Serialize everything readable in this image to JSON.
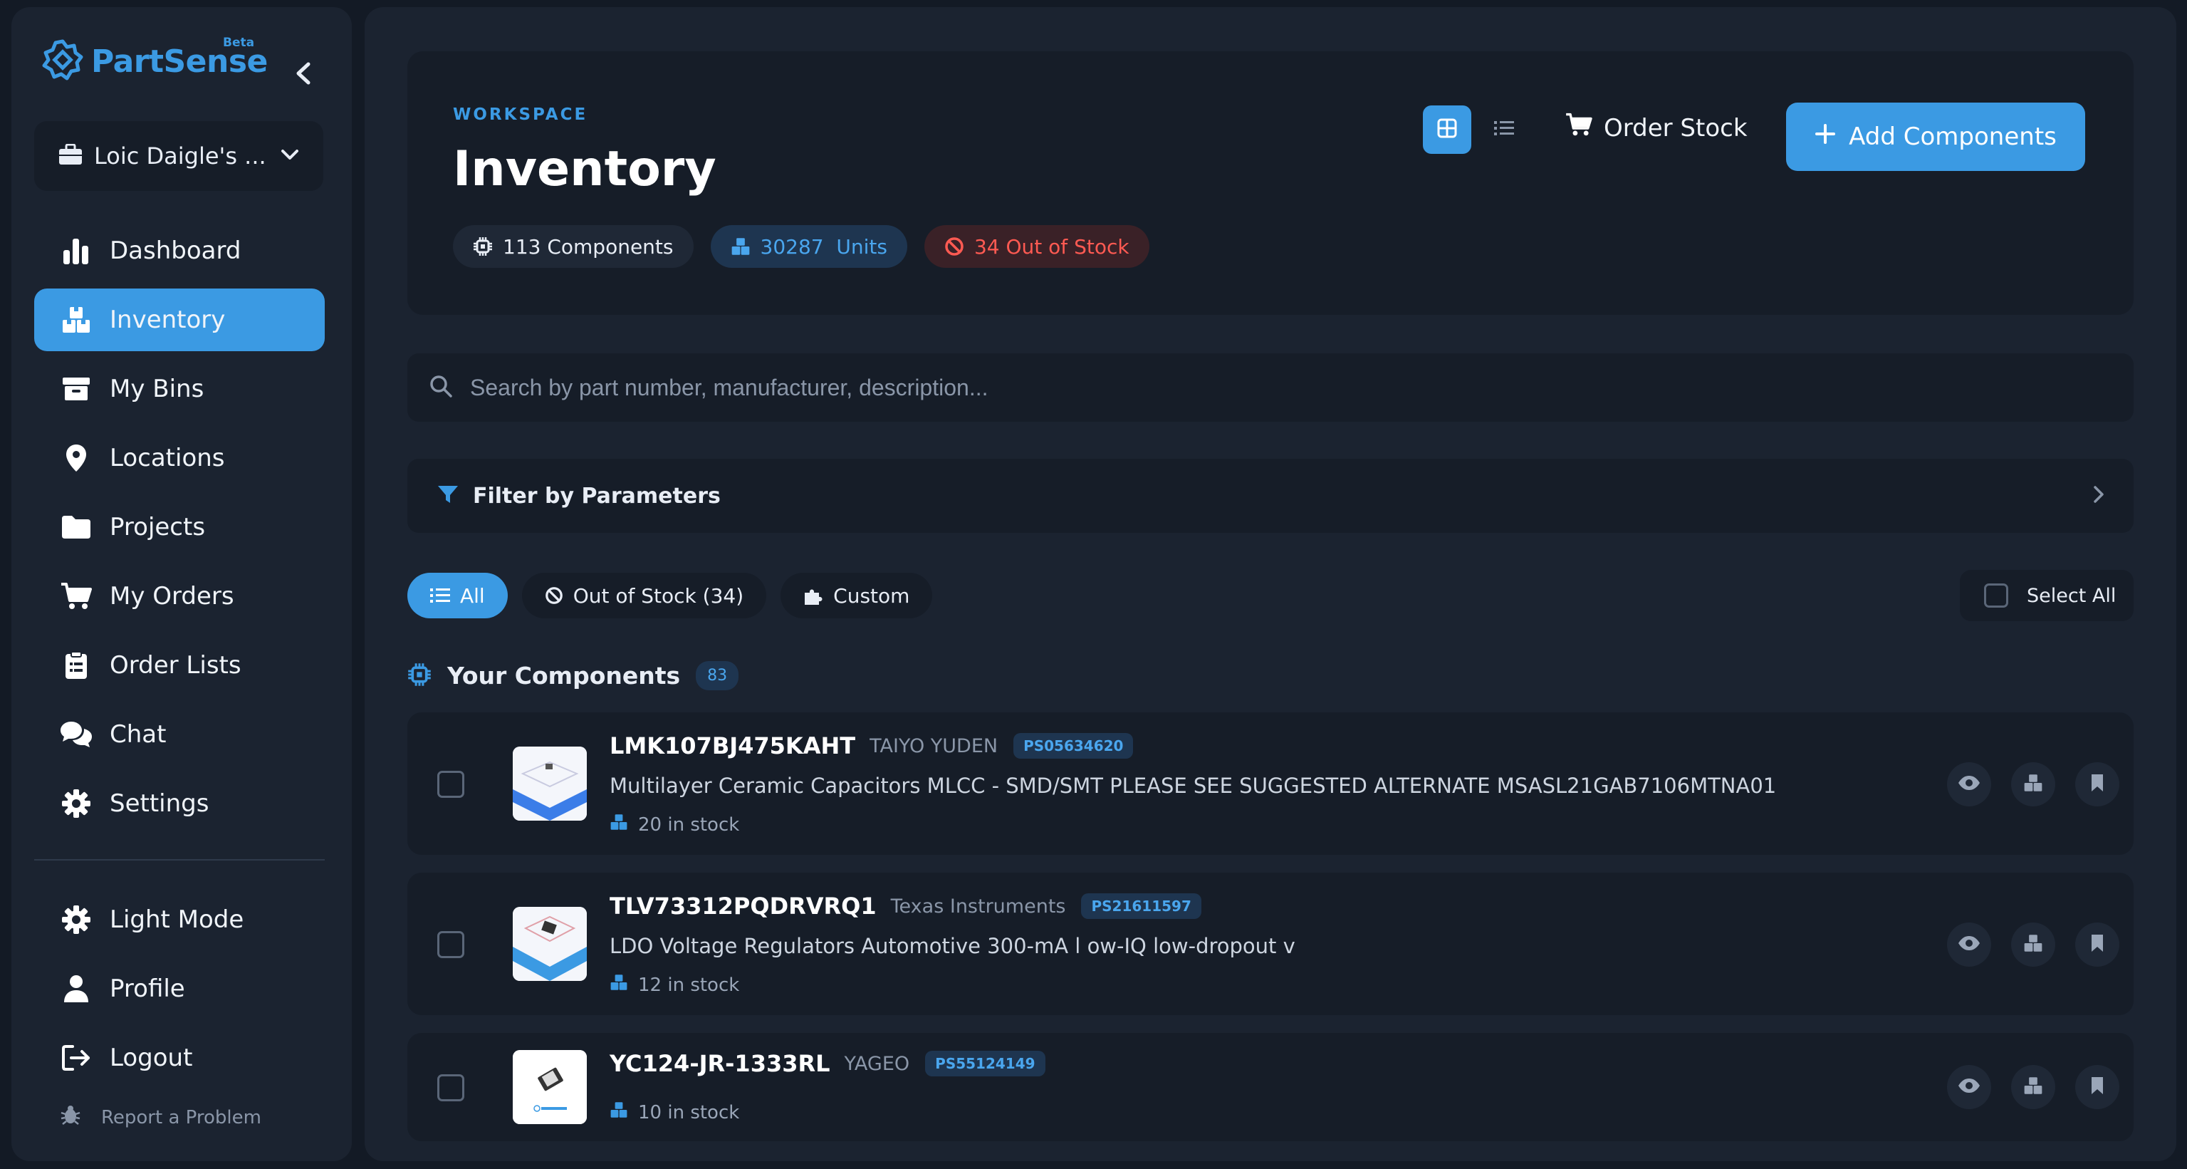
{
  "brand": {
    "name": "PartSense",
    "tag": "Beta"
  },
  "workspace": {
    "name": "Loic Daigle's ..."
  },
  "nav": [
    {
      "label": "Dashboard",
      "icon": "chart-bars-icon"
    },
    {
      "label": "Inventory",
      "icon": "boxes-icon",
      "active": true
    },
    {
      "label": "My Bins",
      "icon": "archive-icon"
    },
    {
      "label": "Locations",
      "icon": "map-pin-icon"
    },
    {
      "label": "Projects",
      "icon": "folder-icon"
    },
    {
      "label": "My Orders",
      "icon": "cart-icon"
    },
    {
      "label": "Order Lists",
      "icon": "clipboard-list-icon"
    },
    {
      "label": "Chat",
      "icon": "chat-bubbles-icon"
    },
    {
      "label": "Settings",
      "icon": "gear-icon"
    }
  ],
  "nav_bottom": [
    {
      "label": "Light Mode",
      "icon": "sun-gear-icon"
    },
    {
      "label": "Profile",
      "icon": "user-icon"
    },
    {
      "label": "Logout",
      "icon": "logout-icon"
    }
  ],
  "report": "Report a Problem",
  "header": {
    "kicker": "WORKSPACE",
    "title": "Inventory",
    "stats": {
      "components": "113 Components",
      "units_value": "30287",
      "units_label": "Units",
      "out_of_stock": "34 Out of Stock"
    },
    "order_stock": "Order Stock",
    "add_components": "Add Components"
  },
  "search": {
    "placeholder": "Search by part number, manufacturer, description..."
  },
  "filter": {
    "label": "Filter by Parameters"
  },
  "tabs": [
    {
      "label": "All",
      "active": true
    },
    {
      "label": "Out of Stock (34)"
    },
    {
      "label": "Custom"
    }
  ],
  "select_all": "Select All",
  "section": {
    "title": "Your Components",
    "count": "83"
  },
  "components": [
    {
      "part_number": "LMK107BJ475KAHT",
      "manufacturer": "TAIYO YUDEN",
      "ps_id": "PS05634620",
      "description": "Multilayer Ceramic Capacitors MLCC - SMD/SMT PLEASE SEE SUGGESTED ALTERNATE MSASL21GAB7106MTNA01",
      "stock": "20 in stock"
    },
    {
      "part_number": "TLV73312PQDRVRQ1",
      "manufacturer": "Texas Instruments",
      "ps_id": "PS21611597",
      "description": "LDO Voltage Regulators Automotive 300-mA l ow-IQ low-dropout v",
      "stock": "12 in stock"
    },
    {
      "part_number": "YC124-JR-1333RL",
      "manufacturer": "YAGEO",
      "ps_id": "PS55124149",
      "description": "",
      "stock": "10 in stock"
    }
  ],
  "colors": {
    "accent": "#3b9ae3",
    "danger": "#ff5a52",
    "panel": "#1b2330",
    "card": "#161d28"
  }
}
